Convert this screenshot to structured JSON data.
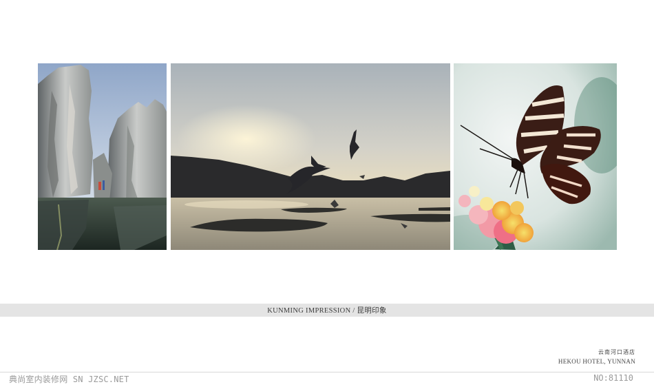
{
  "gallery": {
    "stone_forest_alt": "stone forest",
    "lake_alt": "lake with birds",
    "butterfly_alt": "butterfly"
  },
  "caption": {
    "text": "KUNMING IMPRESSION / 昆明印象"
  },
  "hotel": {
    "name_cn": "云南河口酒店",
    "name_en": "HEKOU HOTEL, YUNNAN"
  },
  "footer": {
    "watermark": "典尚室内装修网 SN JZSC.NET",
    "number": "NO:81110"
  },
  "colors": {
    "background": "#ffffff",
    "caption_band": "#e4e4e4",
    "text": "#444444",
    "footer_text": "#9a9a9a"
  }
}
